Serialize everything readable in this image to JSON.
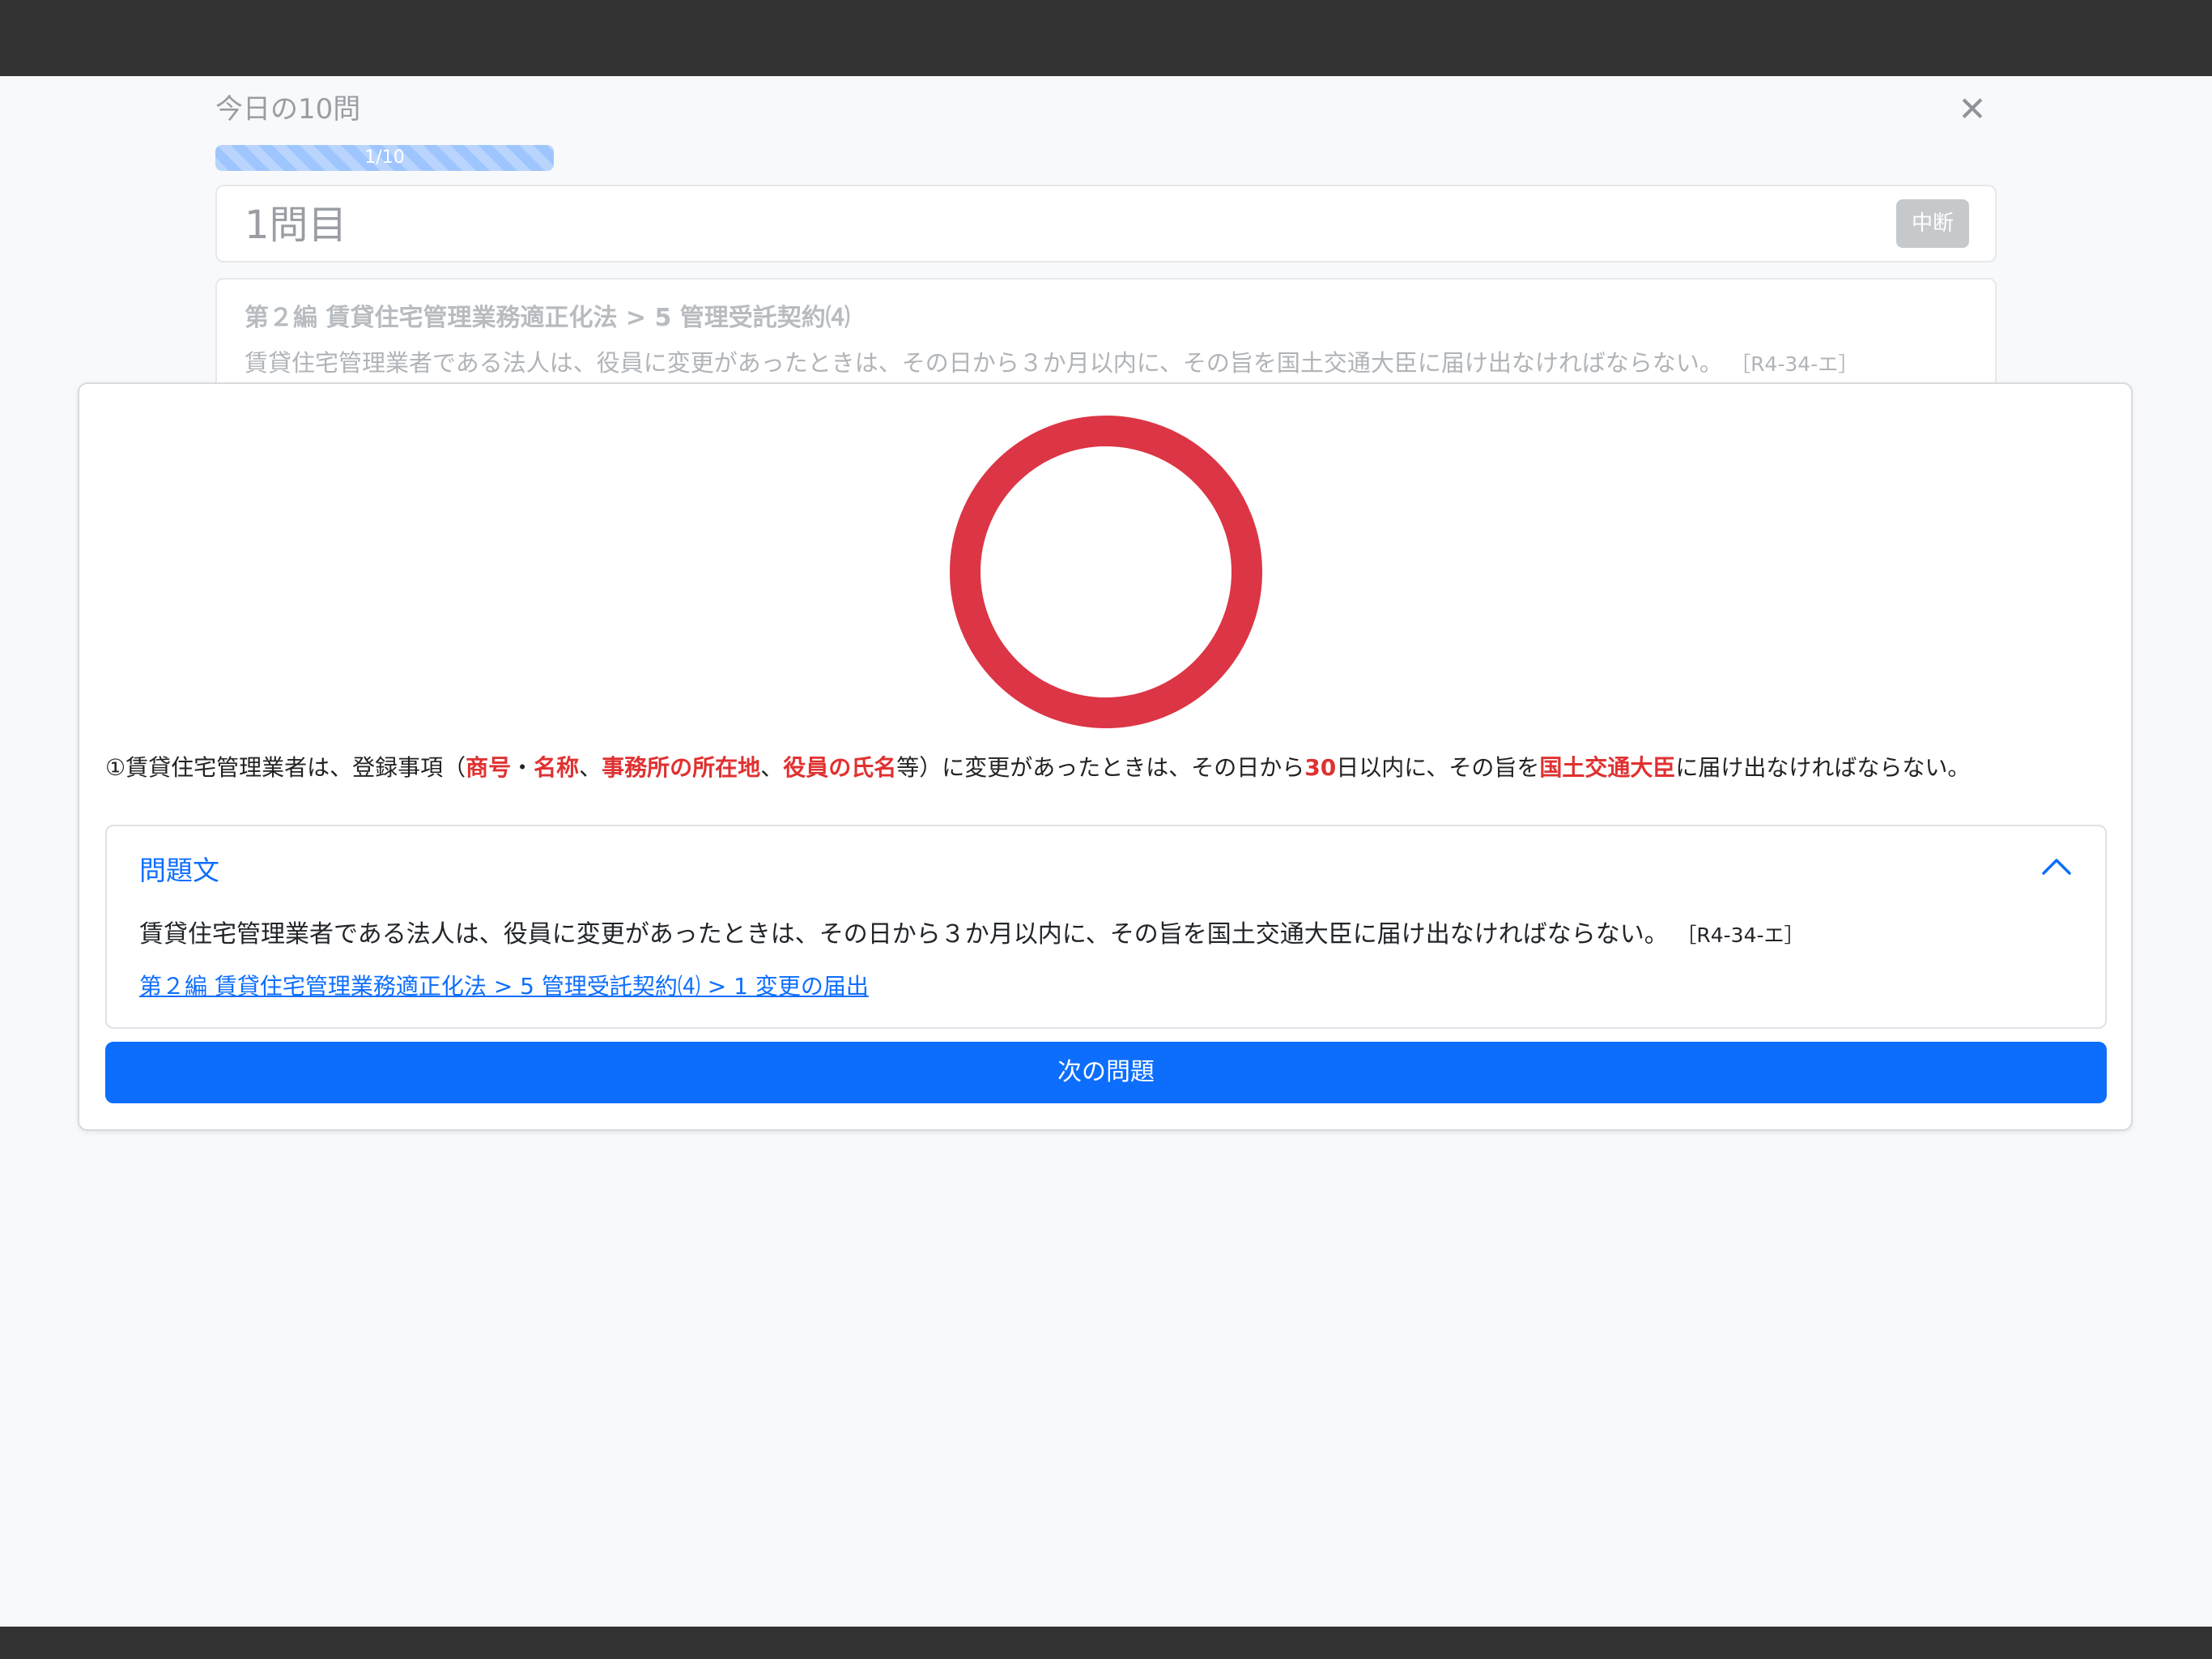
{
  "header": {
    "title": "今日の10問",
    "close_icon": "close-icon"
  },
  "progress": {
    "label": "1/10",
    "current": 1,
    "total": 10,
    "fraction": 0.1
  },
  "question_card": {
    "number_label": "1問目",
    "pause_label": "中断"
  },
  "background_question": {
    "chapter": "第２編 賃貸住宅管理業務適正化法 > 5 管理受託契約⑷",
    "text": "賃貸住宅管理業者である法人は、役員に変更があったときは、その日から３か月以内に、その旨を国土交通大臣に届け出なければならない。",
    "ref": "［R4-34-エ］"
  },
  "result": {
    "mark_icon": "correct-circle-icon",
    "mark_color": "#dc3545",
    "explanation": {
      "p1": "①賃貸住宅管理業者は、登録事項（",
      "h1": "商号",
      "p2": "・",
      "h2": "名称",
      "p3": "、",
      "h3": "事務所の所在地",
      "p4": "、",
      "h4": "役員の氏名",
      "p5": "等）に変更があったときは、その日から",
      "h5": "30",
      "p6": "日以内に、その旨を",
      "h6": "国土交通大臣",
      "p7": "に届け出なければならない。"
    },
    "highlight_color": "#e03131"
  },
  "accordion": {
    "header": "問題文",
    "chevron_icon": "chevron-up-icon",
    "question_text": "賃貸住宅管理業者である法人は、役員に変更があったときは、その日から３か月以内に、その旨を国土交通大臣に届け出なければならない。",
    "ref": "［R4-34-エ］",
    "link": "第２編 賃貸住宅管理業務適正化法 > 5 管理受託契約⑷ > 1 変更の届出"
  },
  "next_button": {
    "label": "次の問題",
    "color": "#0d6efd"
  }
}
